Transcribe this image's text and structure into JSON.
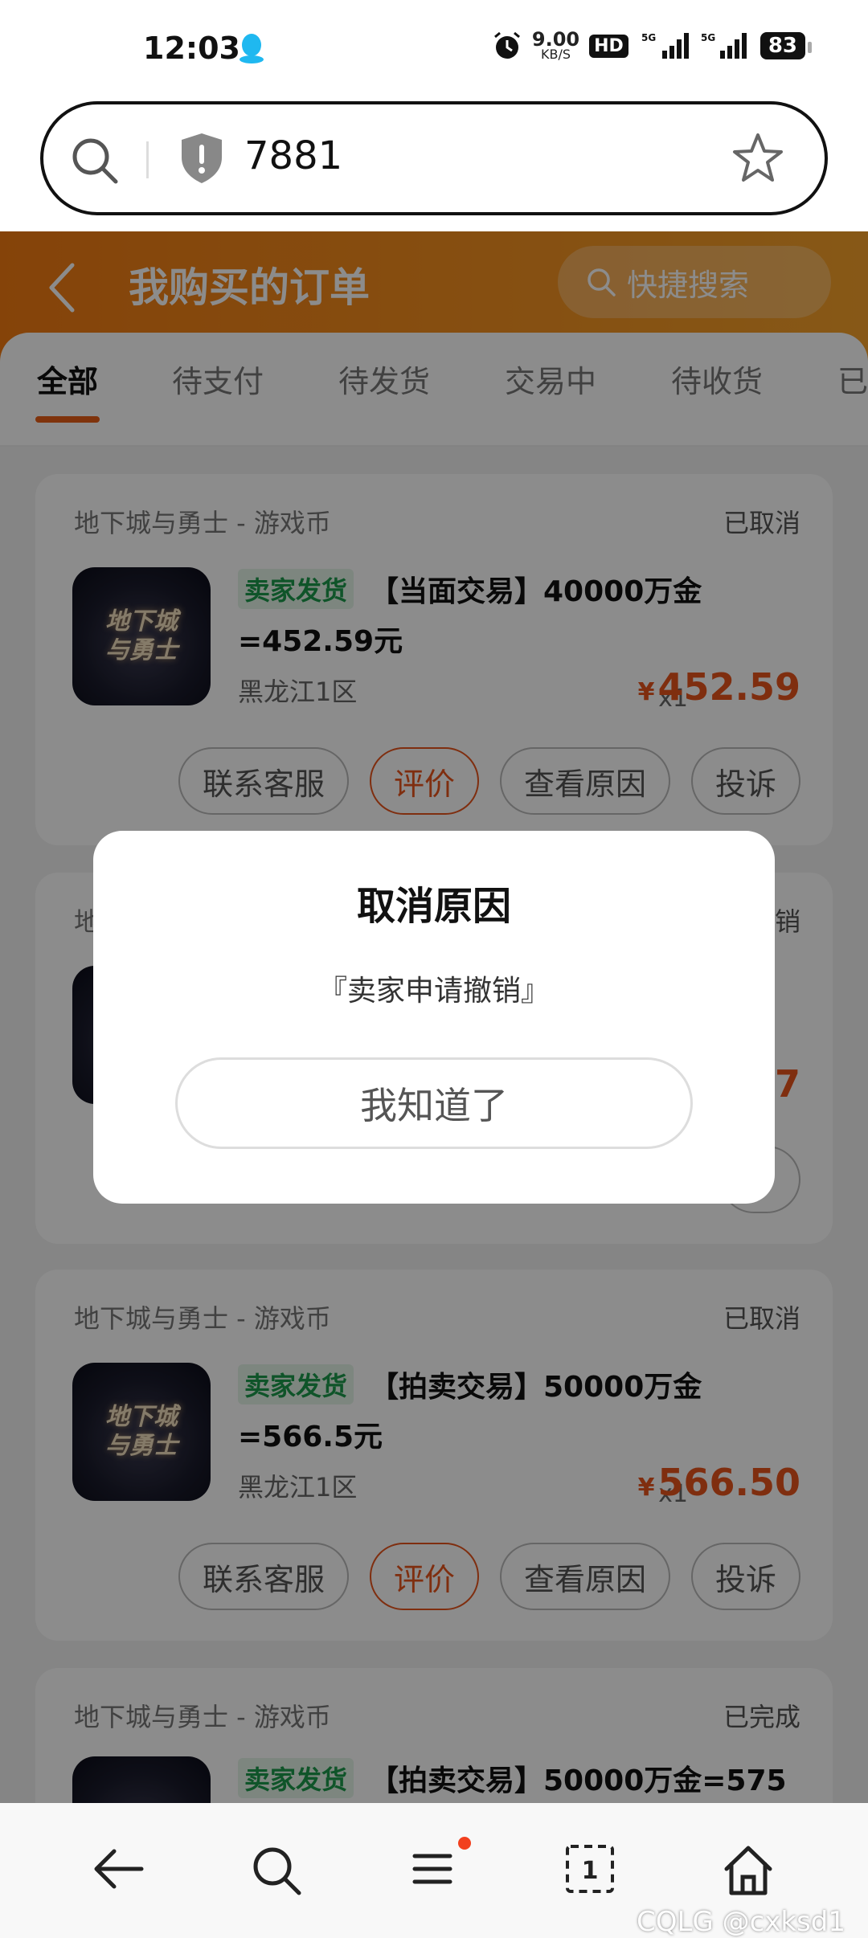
{
  "status_bar": {
    "time": "12:03",
    "net_speed": "9.00",
    "net_unit": "KB/S",
    "hd_label": "HD",
    "sim1": "1",
    "sim2": "2",
    "net_type": "5G",
    "battery": "83"
  },
  "address_bar": {
    "url": "7881"
  },
  "header": {
    "title": "我购买的订单",
    "quick_search": "快捷搜索"
  },
  "tabs": [
    {
      "label": "全部",
      "active": true
    },
    {
      "label": "待支付"
    },
    {
      "label": "待发货"
    },
    {
      "label": "交易中"
    },
    {
      "label": "待收货"
    },
    {
      "label": "已"
    }
  ],
  "orders": [
    {
      "shop": "地下城与勇士 - 游戏币",
      "status": "已取消",
      "thumb_line1": "地下城",
      "thumb_line2": "与勇士",
      "badge": "卖家发货",
      "title": "【当面交易】40000万金=452.59元",
      "region": "黑龙江1区",
      "qty": "x1",
      "price_symbol": "¥",
      "price": "452.59",
      "buttons": [
        "联系客服",
        "评价",
        "查看原因",
        "投诉"
      ]
    },
    {
      "shop": "地",
      "status": "销",
      "price_tail": "7"
    },
    {
      "shop": "地下城与勇士 - 游戏币",
      "status": "已取消",
      "thumb_line1": "地下城",
      "thumb_line2": "与勇士",
      "badge": "卖家发货",
      "title": "【拍卖交易】50000万金=566.5元",
      "region": "黑龙江1区",
      "qty": "x1",
      "price_symbol": "¥",
      "price": "566.50",
      "buttons": [
        "联系客服",
        "评价",
        "查看原因",
        "投诉"
      ]
    },
    {
      "shop": "地下城与勇士 - 游戏币",
      "status": "已完成",
      "badge": "卖家发货",
      "title": "【拍卖交易】50000万金=575"
    }
  ],
  "dialog": {
    "title": "取消原因",
    "message": "『卖家申请撤销』",
    "confirm": "我知道了"
  },
  "watermark": "CQLG @cxksd1"
}
